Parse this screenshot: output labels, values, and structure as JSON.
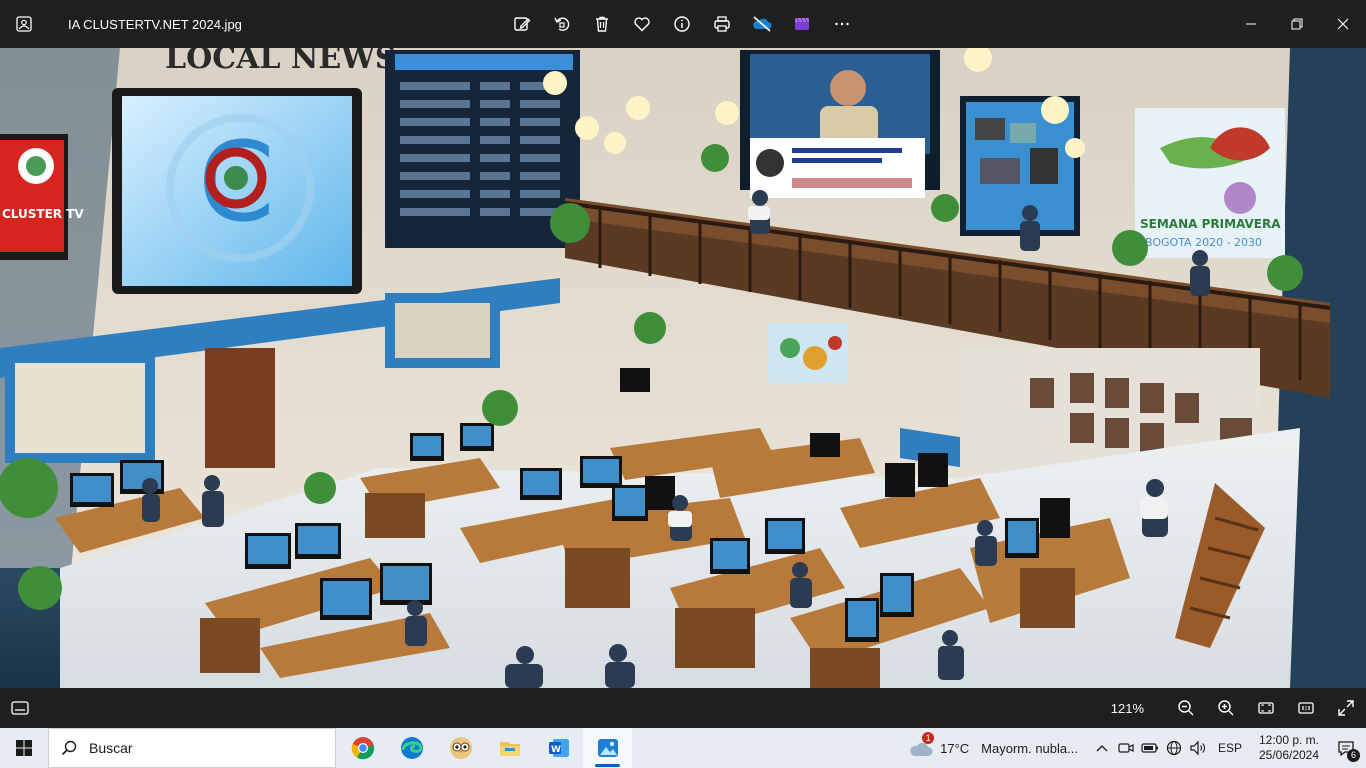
{
  "window": {
    "title": "IA CLUSTERTV.NET  2024.jpg",
    "toolbar": [
      {
        "name": "edit-image-icon"
      },
      {
        "name": "rotate-icon"
      },
      {
        "name": "delete-icon"
      },
      {
        "name": "favorite-heart-icon"
      },
      {
        "name": "info-icon"
      },
      {
        "name": "print-icon"
      },
      {
        "name": "onedrive-icon"
      },
      {
        "name": "clipchamp-icon"
      },
      {
        "name": "more-options-icon"
      }
    ],
    "controls": [
      "minimize-icon",
      "restore-icon",
      "close-icon"
    ]
  },
  "photo": {
    "sign_local_news": "LOCAL NEWS",
    "screen_cluster": "CLUSTER TV",
    "screen_semana": "SEMANA PRIMAVERA",
    "screen_bogota": "BOGOTA 2020 - 2030",
    "colors": {
      "wall": "#e8e2d6",
      "blue_band": "#2f7fc0",
      "wood": "#8a5a34",
      "floor": "#e9eef0"
    }
  },
  "photobar": {
    "zoom_level": "121%"
  },
  "taskbar": {
    "search_label": "Buscar",
    "apps": [
      "chrome-icon",
      "edge-icon",
      "owl-app-icon",
      "file-explorer-icon",
      "word-icon",
      "photos-icon"
    ],
    "active_app": "photos-icon",
    "weather_badge": "1",
    "weather_temp": "17°C",
    "weather_desc": "Mayorm. nubla...",
    "language": "ESP",
    "time": "12:00 p. m.",
    "date": "25/06/2024",
    "notification_badge": "6"
  }
}
